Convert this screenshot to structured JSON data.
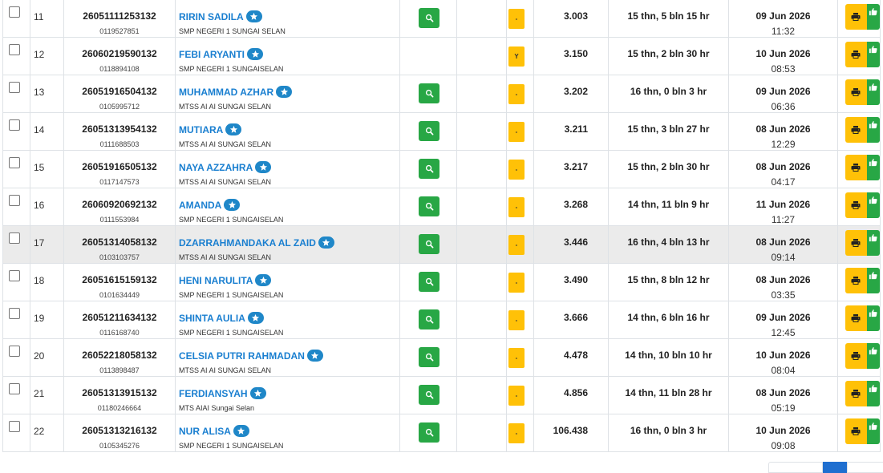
{
  "rows": [
    {
      "no": "11",
      "nisn": "26051111253132",
      "sub": "0119527851",
      "name": "RIRIN SADILA",
      "school": "SMP NEGERI 1 SUNGAI SELAN",
      "detail": true,
      "status": "-",
      "score": "3.003",
      "age": "15 thn, 5 bln 15 hr",
      "date": "09 Jun 2026",
      "time": "11:32",
      "highlight": false
    },
    {
      "no": "12",
      "nisn": "26060219590132",
      "sub": "0118894108",
      "name": "FEBI ARYANTI",
      "school": "SMP NEGERI 1 SUNGAISELAN",
      "detail": false,
      "status": "Y",
      "score": "3.150",
      "age": "15 thn, 2 bln 30 hr",
      "date": "10 Jun 2026",
      "time": "08:53",
      "highlight": false
    },
    {
      "no": "13",
      "nisn": "26051916504132",
      "sub": "0105995712",
      "name": "MUHAMMAD AZHAR",
      "school": "MTSS AI AI SUNGAI SELAN",
      "detail": true,
      "status": "-",
      "score": "3.202",
      "age": "16 thn, 0 bln 3 hr",
      "date": "09 Jun 2026",
      "time": "06:36",
      "highlight": false
    },
    {
      "no": "14",
      "nisn": "26051313954132",
      "sub": "0111688503",
      "name": "MUTIARA",
      "school": "MTSS AI AI SUNGAI SELAN",
      "detail": true,
      "status": "-",
      "score": "3.211",
      "age": "15 thn, 3 bln 27 hr",
      "date": "08 Jun 2026",
      "time": "12:29",
      "highlight": false
    },
    {
      "no": "15",
      "nisn": "26051916505132",
      "sub": "0117147573",
      "name": "NAYA AZZAHRA",
      "school": "MTSS AI AI SUNGAI SELAN",
      "detail": true,
      "status": "-",
      "score": "3.217",
      "age": "15 thn, 2 bln 30 hr",
      "date": "08 Jun 2026",
      "time": "04:17",
      "highlight": false
    },
    {
      "no": "16",
      "nisn": "26060920692132",
      "sub": "0111553984",
      "name": "AMANDA",
      "school": "SMP NEGERI 1 SUNGAISELAN",
      "detail": true,
      "status": "-",
      "score": "3.268",
      "age": "14 thn, 11 bln 9 hr",
      "date": "11 Jun 2026",
      "time": "11:27",
      "highlight": false
    },
    {
      "no": "17",
      "nisn": "26051314058132",
      "sub": "0103103757",
      "name": "DZARRAHMANDAKA AL ZAID",
      "school": "MTSS AI AI SUNGAI SELAN",
      "detail": true,
      "status": "-",
      "score": "3.446",
      "age": "16 thn, 4 bln 13 hr",
      "date": "08 Jun 2026",
      "time": "09:14",
      "highlight": true
    },
    {
      "no": "18",
      "nisn": "26051615159132",
      "sub": "0101634449",
      "name": "HENI NARULITA",
      "school": "SMP NEGERI 1 SUNGAISELAN",
      "detail": true,
      "status": "-",
      "score": "3.490",
      "age": "15 thn, 8 bln 12 hr",
      "date": "08 Jun 2026",
      "time": "03:35",
      "highlight": false
    },
    {
      "no": "19",
      "nisn": "26051211634132",
      "sub": "0116168740",
      "name": "SHINTA AULIA",
      "school": "SMP NEGERI 1 SUNGAISELAN",
      "detail": true,
      "status": "-",
      "score": "3.666",
      "age": "14 thn, 6 bln 16 hr",
      "date": "09 Jun 2026",
      "time": "12:45",
      "highlight": false
    },
    {
      "no": "20",
      "nisn": "26052218058132",
      "sub": "0113898487",
      "name": "CELSIA PUTRI RAHMADAN",
      "school": "MTSS AI AI SUNGAI SELAN",
      "detail": true,
      "status": "-",
      "score": "4.478",
      "age": "14 thn, 10 bln 10 hr",
      "date": "10 Jun 2026",
      "time": "08:04",
      "highlight": false
    },
    {
      "no": "21",
      "nisn": "26051313915132",
      "sub": "01180246664",
      "name": "FERDIANSYAH",
      "school": "MTS AIAI Sungai Selan",
      "detail": true,
      "status": "-",
      "score": "4.856",
      "age": "14 thn, 11 bln 28 hr",
      "date": "08 Jun 2026",
      "time": "05:19",
      "highlight": false
    },
    {
      "no": "22",
      "nisn": "26051313216132",
      "sub": "0105345276",
      "name": "NUR ALISA",
      "school": "SMP NEGERI 1 SUNGAISELAN",
      "detail": true,
      "status": "-",
      "score": "106.438",
      "age": "16 thn, 0 bln 3 hr",
      "date": "10 Jun 2026",
      "time": "09:08",
      "highlight": false
    }
  ],
  "icons": {
    "verified": "star-badge-icon",
    "detail": "search-icon",
    "print": "print-icon",
    "approve": "thumbs-up-icon"
  },
  "colors": {
    "link": "#1a7fd0",
    "badge": "#1f87c8",
    "success": "#28a745",
    "warning": "#ffc107",
    "row_highlight": "#ebebeb",
    "pager_active": "#1f6fd0"
  }
}
